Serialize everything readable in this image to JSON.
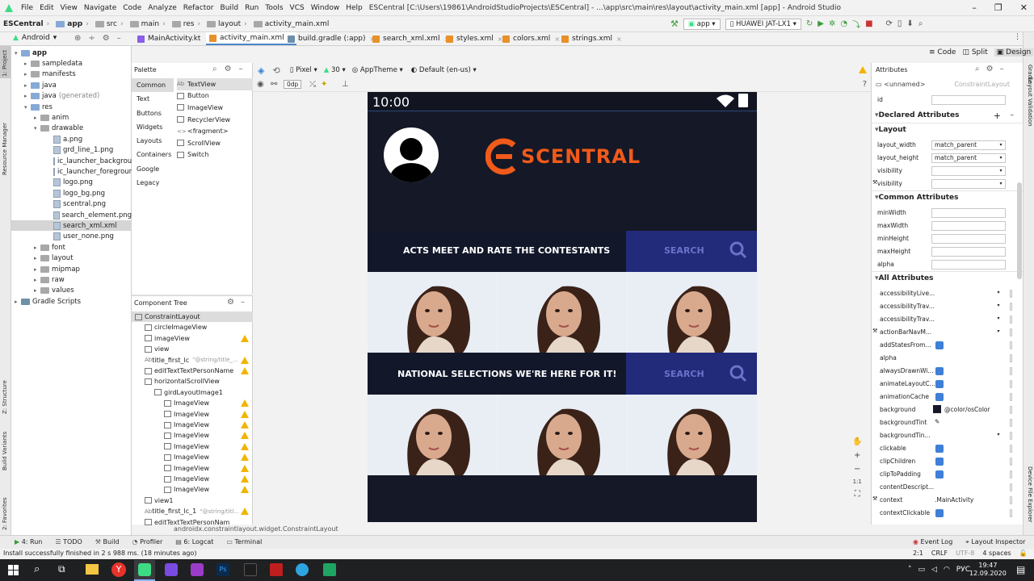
{
  "menu": {
    "items": [
      "File",
      "Edit",
      "View",
      "Navigate",
      "Code",
      "Analyze",
      "Refactor",
      "Build",
      "Run",
      "Tools",
      "VCS",
      "Window",
      "Help"
    ],
    "window_title": "ESCentral [C:\\Users\\19861\\AndroidStudioProjects\\ESCentral] - ...\\app\\src\\main\\res\\layout\\activity_main.xml [app] - Android Studio"
  },
  "breadcrumb": [
    "ESCentral",
    "app",
    "src",
    "main",
    "res",
    "layout",
    "activity_main.xml"
  ],
  "run_config": "app",
  "device": "HUAWEI JAT-LX1",
  "project_view": "Android",
  "editor_tabs": [
    "MainActivity.kt",
    "activity_main.xml",
    "build.gradle (:app)",
    "search_xml.xml",
    "styles.xml",
    "colors.xml",
    "strings.xml"
  ],
  "view_modes": [
    "Code",
    "Split",
    "Design"
  ],
  "project_tree": [
    {
      "label": "app",
      "level": 0,
      "kind": "folder",
      "bold": true
    },
    {
      "label": "sampledata",
      "level": 1,
      "kind": "folder"
    },
    {
      "label": "manifests",
      "level": 1,
      "kind": "folder"
    },
    {
      "label": "java",
      "level": 1,
      "kind": "folder"
    },
    {
      "label": "java",
      "suffix": "(generated)",
      "level": 1,
      "kind": "folder"
    },
    {
      "label": "res",
      "level": 1,
      "kind": "folder"
    },
    {
      "label": "anim",
      "level": 2,
      "kind": "folder"
    },
    {
      "label": "drawable",
      "level": 2,
      "kind": "folder"
    },
    {
      "label": "a.png",
      "level": 3,
      "kind": "file"
    },
    {
      "label": "grd_line_1.png",
      "level": 3,
      "kind": "file"
    },
    {
      "label": "ic_launcher_backgrour",
      "level": 3,
      "kind": "file"
    },
    {
      "label": "ic_launcher_foregroun",
      "level": 3,
      "kind": "file"
    },
    {
      "label": "logo.png",
      "level": 3,
      "kind": "file"
    },
    {
      "label": "logo_bg.png",
      "level": 3,
      "kind": "file"
    },
    {
      "label": "scentral.png",
      "level": 3,
      "kind": "file"
    },
    {
      "label": "search_element.png",
      "level": 3,
      "kind": "file"
    },
    {
      "label": "search_xml.xml",
      "level": 3,
      "kind": "file",
      "selected": true
    },
    {
      "label": "user_none.png",
      "level": 3,
      "kind": "file"
    },
    {
      "label": "font",
      "level": 2,
      "kind": "folder"
    },
    {
      "label": "layout",
      "level": 2,
      "kind": "folder"
    },
    {
      "label": "mipmap",
      "level": 2,
      "kind": "folder"
    },
    {
      "label": "raw",
      "level": 2,
      "kind": "folder"
    },
    {
      "label": "values",
      "level": 2,
      "kind": "folder"
    },
    {
      "label": "Gradle Scripts",
      "level": 0,
      "kind": "gradle"
    }
  ],
  "palette": {
    "title": "Palette",
    "categories": [
      "Common",
      "Text",
      "Buttons",
      "Widgets",
      "Layouts",
      "Containers",
      "Google",
      "Legacy"
    ],
    "items": [
      {
        "prefix": "Ab",
        "label": "TextView"
      },
      {
        "prefix": "",
        "label": "Button"
      },
      {
        "prefix": "",
        "label": "ImageView"
      },
      {
        "prefix": "",
        "label": "RecyclerView"
      },
      {
        "prefix": "<>",
        "label": "<fragment>"
      },
      {
        "prefix": "",
        "label": "ScrollView"
      },
      {
        "prefix": "",
        "label": "Switch"
      }
    ]
  },
  "component_tree": {
    "title": "Component Tree",
    "rows": [
      {
        "label": "ConstraintLayout",
        "level": 0,
        "warn": false
      },
      {
        "label": "circleImageView",
        "level": 1,
        "warn": false
      },
      {
        "label": "imageView",
        "level": 1,
        "warn": true
      },
      {
        "label": "view",
        "level": 1,
        "warn": false
      },
      {
        "label": "title_first_lc",
        "hint": "\"@string/title_...",
        "level": 1,
        "warn": true,
        "ab": true
      },
      {
        "label": "editTextTextPersonName",
        "level": 1,
        "warn": true
      },
      {
        "label": "horizontalScrollView",
        "level": 1,
        "warn": false
      },
      {
        "label": "girdLayoutImage1",
        "level": 2,
        "warn": false
      },
      {
        "label": "ImageView",
        "level": 3,
        "warn": true
      },
      {
        "label": "ImageView",
        "level": 3,
        "warn": true
      },
      {
        "label": "ImageView",
        "level": 3,
        "warn": true
      },
      {
        "label": "ImageView",
        "level": 3,
        "warn": true
      },
      {
        "label": "ImageView",
        "level": 3,
        "warn": true
      },
      {
        "label": "ImageView",
        "level": 3,
        "warn": true
      },
      {
        "label": "ImageView",
        "level": 3,
        "warn": true
      },
      {
        "label": "ImageView",
        "level": 3,
        "warn": true
      },
      {
        "label": "ImageView",
        "level": 3,
        "warn": true
      },
      {
        "label": "view1",
        "level": 1,
        "warn": false
      },
      {
        "label": "title_first_lc_1",
        "hint": "\"@string/titl...",
        "level": 1,
        "warn": true,
        "ab": true
      },
      {
        "label": "editTextTextPersonNam",
        "level": 1,
        "warn": false
      }
    ]
  },
  "design_toolbar": {
    "device": "Pixel",
    "api": "30",
    "theme": "AppTheme",
    "locale": "Default (en-us)",
    "margin": "0dp"
  },
  "phone": {
    "time": "10:00",
    "brand": "SCENTRAL",
    "bar1_title": "ACTS MEET AND RATE THE CONTESTANTS",
    "bar2_title": "NATIONAL SELECTIONS WE'RE HERE FOR IT!",
    "search_label": "SEARCH",
    "bg_color": "#151826",
    "bar_color": "#161b2e",
    "search_color": "#222a7a",
    "accent": "#f05a1a"
  },
  "attributes": {
    "title": "Attributes",
    "element": "<unnamed>",
    "element_type": "ConstraintLayout",
    "id_label": "id",
    "declared_title": "Declared Attributes",
    "layout_title": "Layout",
    "layout_rows": [
      {
        "k": "layout_width",
        "v": "match_parent"
      },
      {
        "k": "layout_height",
        "v": "match_parent"
      },
      {
        "k": "visibility",
        "v": ""
      },
      {
        "k": "visibility",
        "v": "",
        "tool": true
      }
    ],
    "common_title": "Common Attributes",
    "common_rows": [
      "minWidth",
      "maxWidth",
      "minHeight",
      "maxHeight",
      "alpha"
    ],
    "all_title": "All Attributes",
    "all_rows": [
      {
        "k": "accessibilityLive...",
        "t": "dd"
      },
      {
        "k": "accessibilityTrav...",
        "t": "dd"
      },
      {
        "k": "accessibilityTrav...",
        "t": "dd"
      },
      {
        "k": "actionBarNavM...",
        "t": "dd",
        "tool": true
      },
      {
        "k": "addStatesFrom...",
        "t": "cb"
      },
      {
        "k": "alpha",
        "t": "none"
      },
      {
        "k": "alwaysDrawnWi...",
        "t": "cb"
      },
      {
        "k": "animateLayoutC...",
        "t": "cb"
      },
      {
        "k": "animationCache",
        "t": "cb"
      },
      {
        "k": "background",
        "t": "color",
        "v": "@color/osColor"
      },
      {
        "k": "backgroundTint",
        "t": "pick"
      },
      {
        "k": "backgroundTin...",
        "t": "dd"
      },
      {
        "k": "clickable",
        "t": "cb"
      },
      {
        "k": "clipChildren",
        "t": "cb"
      },
      {
        "k": "clipToPadding",
        "t": "cb"
      },
      {
        "k": "contentDescript...",
        "t": "none"
      },
      {
        "k": "context",
        "t": "text",
        "v": ".MainActivity",
        "tool": true
      },
      {
        "k": "contextClickable",
        "t": "cb"
      }
    ]
  },
  "bottom_path": "androidx.constraintlayout.widget.ConstraintLayout",
  "left_strip": [
    "1: Project",
    "Resource Manager",
    "Z: Structure",
    "Build Variants",
    "2: Favorites"
  ],
  "right_strip": [
    "Gradle",
    "Layout Validation",
    "Device File Explorer"
  ],
  "bottom_tabs": [
    "4: Run",
    "TODO",
    "Build",
    "Profiler",
    "6: Logcat",
    "Terminal"
  ],
  "bottom_right_tabs": [
    "Event Log",
    "Layout Inspector"
  ],
  "status": {
    "message": "Install successfully finished in 2 s 988 ms. (18 minutes ago)",
    "position": "2:1",
    "line_sep": "CRLF",
    "encoding": "UTF-8",
    "indent": "4 spaces"
  },
  "taskbar": {
    "lang": "РУС",
    "time": "19:47",
    "date": "12.09.2020"
  }
}
